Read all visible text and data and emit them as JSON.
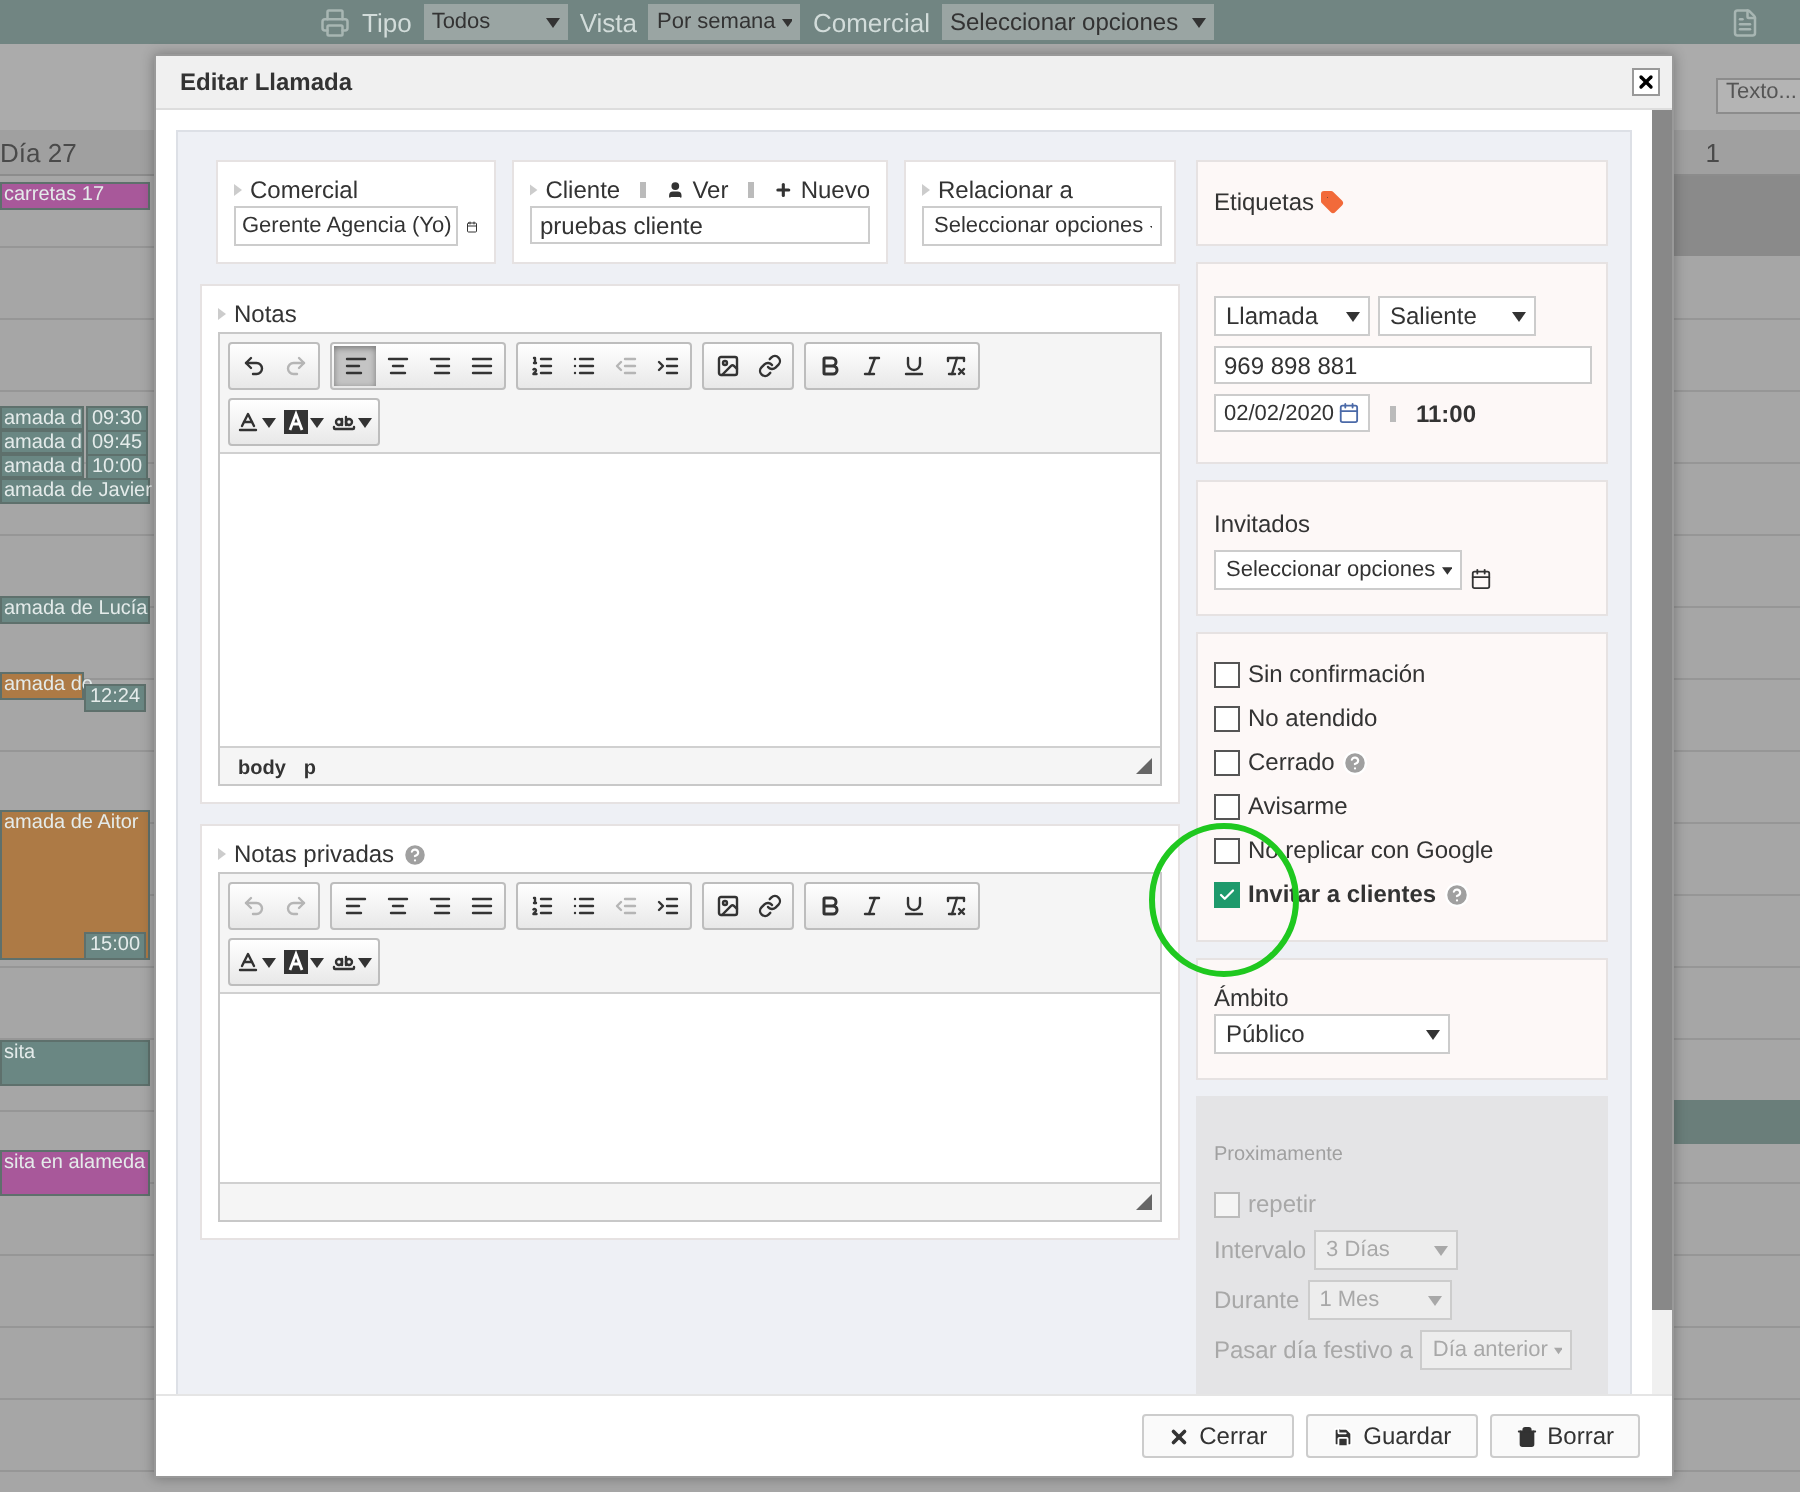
{
  "background": {
    "toolbar": {
      "tipo_label": "Tipo",
      "tipo_value": "Todos",
      "vista_label": "Vista",
      "vista_value": "Por semana",
      "comercial_label": "Comercial",
      "comercial_value": "Seleccionar opciones"
    },
    "search_placeholder": "Texto...",
    "day_header": "Día 27",
    "right_header": "1",
    "events": [
      {
        "title": "carretas 17",
        "color": "#a8589a"
      },
      {
        "title": "amada d",
        "time": "09:30",
        "color": "#6a8783"
      },
      {
        "title": "amada d",
        "time": "09:45",
        "color": "#6a8783"
      },
      {
        "title": "amada d",
        "time": "10:00",
        "color": "#6a8783"
      },
      {
        "title": "amada de Javier",
        "color": "#6a8783"
      },
      {
        "title": "amada de Lucía",
        "color": "#6a8783"
      },
      {
        "title": "amada de",
        "time": "12:24",
        "color": "#ad7a45"
      },
      {
        "title": "amada de Aitor",
        "time": "15:00",
        "color": "#ad7a45"
      },
      {
        "title": "sita",
        "color": "#6a8783"
      },
      {
        "title": "sita en alameda",
        "color": "#a8589a"
      }
    ]
  },
  "dialog": {
    "title": "Editar Llamada",
    "comercial": {
      "label": "Comercial",
      "value": "Gerente Agencia (Yo)"
    },
    "cliente": {
      "label": "Cliente",
      "ver": "Ver",
      "nuevo": "Nuevo",
      "value": "pruebas cliente"
    },
    "relacionar": {
      "label": "Relacionar a",
      "value": "Seleccionar opciones"
    },
    "editors": [
      {
        "label": "Notas",
        "help": false,
        "path": [
          "body",
          "p"
        ],
        "toolbar_rows": [
          [
            {
              "tools": [
                {
                  "kind": "undo",
                  "disabled": false,
                  "selected": false
                },
                {
                  "kind": "redo",
                  "disabled": true,
                  "selected": false
                }
              ]
            },
            {
              "tools": [
                {
                  "kind": "align-left",
                  "disabled": false,
                  "selected": true
                },
                {
                  "kind": "align-center",
                  "disabled": false,
                  "selected": false
                },
                {
                  "kind": "align-right",
                  "disabled": false,
                  "selected": false
                },
                {
                  "kind": "justify",
                  "disabled": false,
                  "selected": false
                }
              ]
            },
            {
              "tools": [
                {
                  "kind": "ordered-list",
                  "disabled": false,
                  "selected": false
                },
                {
                  "kind": "bullet-list",
                  "disabled": false,
                  "selected": false
                },
                {
                  "kind": "outdent",
                  "disabled": true,
                  "selected": false
                },
                {
                  "kind": "indent",
                  "disabled": false,
                  "selected": false
                }
              ]
            },
            {
              "tools": [
                {
                  "kind": "image",
                  "disabled": false,
                  "selected": false
                },
                {
                  "kind": "link",
                  "disabled": false,
                  "selected": false
                }
              ]
            },
            {
              "tools": [
                {
                  "kind": "bold",
                  "disabled": false,
                  "selected": false
                },
                {
                  "kind": "italic",
                  "disabled": false,
                  "selected": false
                },
                {
                  "kind": "underline",
                  "disabled": false,
                  "selected": false
                },
                {
                  "kind": "clear-format",
                  "disabled": false,
                  "selected": false
                }
              ]
            }
          ],
          [
            {
              "tools": [
                {
                  "kind": "text-color",
                  "disabled": false
                },
                {
                  "kind": "background-color",
                  "disabled": false
                },
                {
                  "kind": "spellcheck",
                  "disabled": false
                }
              ]
            }
          ]
        ]
      },
      {
        "label": "Notas privadas",
        "help": true,
        "toolbar_rows": [
          [
            {
              "tools": [
                {
                  "kind": "undo",
                  "disabled": true,
                  "selected": false
                },
                {
                  "kind": "redo",
                  "disabled": true,
                  "selected": false
                }
              ]
            },
            {
              "tools": [
                {
                  "kind": "align-left",
                  "disabled": false,
                  "selected": false
                },
                {
                  "kind": "align-center",
                  "disabled": false,
                  "selected": false
                },
                {
                  "kind": "align-right",
                  "disabled": false,
                  "selected": false
                },
                {
                  "kind": "justify",
                  "disabled": false,
                  "selected": false
                }
              ]
            },
            {
              "tools": [
                {
                  "kind": "ordered-list",
                  "disabled": false,
                  "selected": false
                },
                {
                  "kind": "bullet-list",
                  "disabled": false,
                  "selected": false
                },
                {
                  "kind": "outdent",
                  "disabled": true,
                  "selected": false
                },
                {
                  "kind": "indent",
                  "disabled": false,
                  "selected": false
                }
              ]
            },
            {
              "tools": [
                {
                  "kind": "image",
                  "disabled": false,
                  "selected": false
                },
                {
                  "kind": "link",
                  "disabled": false,
                  "selected": false
                }
              ]
            },
            {
              "tools": [
                {
                  "kind": "bold",
                  "disabled": false,
                  "selected": false
                },
                {
                  "kind": "italic",
                  "disabled": false,
                  "selected": false
                },
                {
                  "kind": "underline",
                  "disabled": false,
                  "selected": false
                },
                {
                  "kind": "clear-format",
                  "disabled": false,
                  "selected": false
                }
              ]
            }
          ],
          [
            {
              "tools": [
                {
                  "kind": "text-color",
                  "disabled": false
                },
                {
                  "kind": "background-color",
                  "disabled": false
                },
                {
                  "kind": "spellcheck",
                  "disabled": false
                }
              ]
            }
          ]
        ]
      }
    ],
    "etiquetas": "Etiquetas",
    "tipo": "Llamada",
    "direccion": "Saliente",
    "telefono": "969 898 881",
    "fecha": "02/02/2020",
    "hora": "11:00",
    "invitados": {
      "label": "Invitados",
      "value": "Seleccionar opciones"
    },
    "checkboxes": [
      {
        "label": "Sin confirmación",
        "checked": false,
        "help": false
      },
      {
        "label": "No atendido",
        "checked": false,
        "help": false
      },
      {
        "label": "Cerrado",
        "checked": false,
        "help": true
      },
      {
        "label": "Avisarme",
        "checked": false,
        "help": false
      },
      {
        "label": "No replicar con Google",
        "checked": false,
        "help": false
      },
      {
        "label": "Invitar a clientes",
        "checked": true,
        "help": true
      }
    ],
    "ambito": {
      "label": "Ámbito",
      "value": "Público"
    },
    "recurrence": {
      "heading": "Proximamente",
      "disabled": true,
      "repetir": {
        "label": "repetir",
        "checked": false
      },
      "fields": [
        {
          "label": "Intervalo",
          "value": "3 Días"
        },
        {
          "label": "Durante",
          "value": "1 Mes"
        },
        {
          "label": "Pasar día festivo a",
          "value": "Día anterior"
        }
      ]
    },
    "buttons": [
      {
        "kind": "close",
        "label": "Cerrar"
      },
      {
        "kind": "save",
        "label": "Guardar"
      },
      {
        "kind": "delete",
        "label": "Borrar"
      }
    ]
  }
}
